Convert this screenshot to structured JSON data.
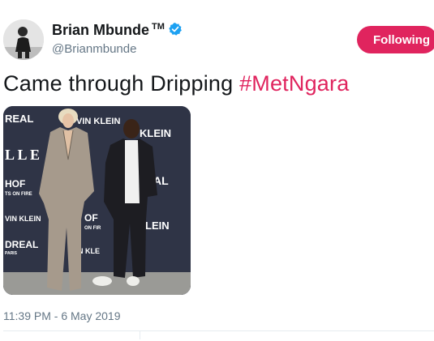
{
  "author": {
    "name": "Brian Mbunde",
    "trademark": "TM",
    "handle": "@Brianmbunde",
    "verified_icon": "verified-badge-icon"
  },
  "follow_button": {
    "label": "Following"
  },
  "tweet": {
    "text": "Came through Dripping ",
    "hashtag": "#MetNgara",
    "timestamp": "11:39 PM - 6 May 2019"
  },
  "media": {
    "backdrop_texts": [
      "REAL",
      "VIN KLEIN",
      "KLEIN",
      "L L E",
      "HOF",
      "TS ON FIRE",
      "VIN KLEIN",
      "OF",
      "ON FIR",
      "LEIN",
      "DREAL",
      "PARIS",
      "N KLE",
      "AL"
    ]
  },
  "colors": {
    "accent": "#e0245e",
    "verified": "#1da1f2",
    "secondary_text": "#657786",
    "divider": "#e6ecf0"
  }
}
